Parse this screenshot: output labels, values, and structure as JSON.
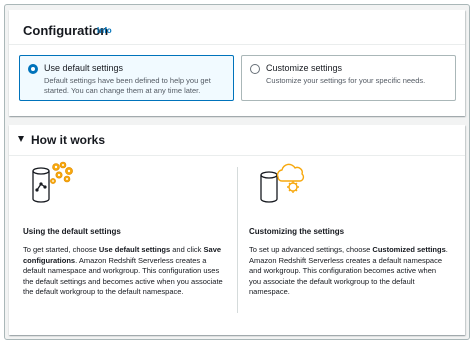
{
  "configuration": {
    "title": "Configuration",
    "info_label": "Info",
    "options": [
      {
        "label": "Use default settings",
        "description": "Default settings have been defined to help you get started. You can change them at any time later.",
        "selected": true
      },
      {
        "label": "Customize settings",
        "description": "Customize your settings for your specific needs.",
        "selected": false
      }
    ]
  },
  "how_it_works": {
    "title": "How it works",
    "expanded": true,
    "default": {
      "icon": "database-gear-icon",
      "title": "Using the default settings",
      "text_1": "To get started, choose ",
      "bold_1": "Use default settings",
      "text_2": " and click ",
      "bold_2": "Save configurations",
      "text_3": ". Amazon Redshift Serverless creates a default namespace and workgroup. This configuration uses the default settings and becomes active when you associate the default workgroup to the default namespace."
    },
    "custom": {
      "icon": "database-cloud-gear-icon",
      "title": "Customizing the settings",
      "text_1": "To set up advanced settings, choose ",
      "bold_1": "Customized settings",
      "text_2": ". Amazon Redshift Serverless creates a default namespace and workgroup. This configuration becomes active when you associate the default workgroup to the default namespace."
    }
  },
  "colors": {
    "accent": "#0073bb",
    "icon_orange": "#f7a80d",
    "text": "#16191f",
    "muted": "#545b64"
  }
}
